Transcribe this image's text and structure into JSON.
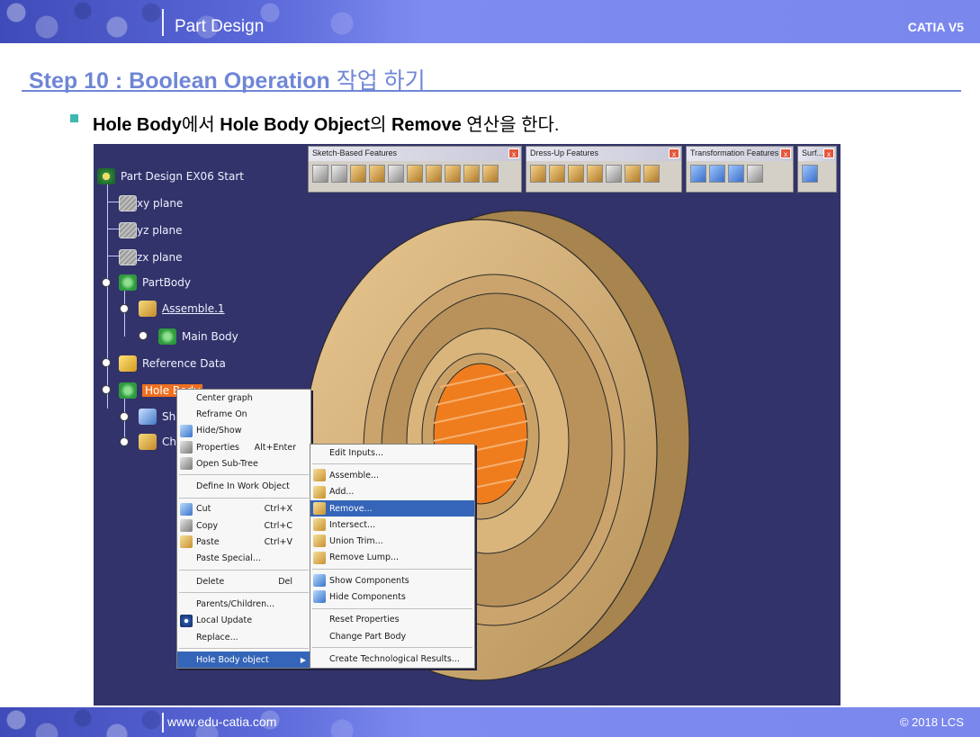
{
  "header": {
    "title": "Part Design",
    "right": "CATIA V5"
  },
  "step": {
    "title_en": "Step 10 : Boolean Operation",
    "title_ko": "작업 하기"
  },
  "bullet": {
    "p1": "Hole Body",
    "p2": "에서 ",
    "p3": "Hole Body Object",
    "p4": "의 ",
    "p5": "Remove",
    "p6": " 연산을 한다."
  },
  "toolbars": [
    {
      "title": "Sketch-Based Features",
      "close": "x"
    },
    {
      "title": "Dress-Up Features",
      "close": "x"
    },
    {
      "title": "Transformation Features",
      "close": "x"
    },
    {
      "title": "Surf...",
      "close": "x"
    }
  ],
  "tree": {
    "root": "Part Design EX06 Start",
    "xy": "xy plane",
    "yz": "yz plane",
    "zx": "zx plane",
    "partbody": "PartBody",
    "assemble": "Assemble.1",
    "mainbody": "Main Body",
    "refdata": "Reference Data",
    "holebody": "Hole Body",
    "sh": "Sh",
    "ch": "Ch"
  },
  "menu1": [
    {
      "label": "Center graph",
      "shortcut": ""
    },
    {
      "label": "Reframe On",
      "shortcut": ""
    },
    {
      "label": "Hide/Show",
      "shortcut": ""
    },
    {
      "label": "Properties",
      "shortcut": "Alt+Enter"
    },
    {
      "label": "Open Sub-Tree",
      "shortcut": ""
    },
    {
      "label": "Define In Work Object",
      "shortcut": ""
    },
    {
      "label": "Cut",
      "shortcut": "Ctrl+X"
    },
    {
      "label": "Copy",
      "shortcut": "Ctrl+C"
    },
    {
      "label": "Paste",
      "shortcut": "Ctrl+V"
    },
    {
      "label": "Paste Special...",
      "shortcut": ""
    },
    {
      "label": "Delete",
      "shortcut": "Del"
    },
    {
      "label": "Parents/Children...",
      "shortcut": ""
    },
    {
      "label": "Local Update",
      "shortcut": ""
    },
    {
      "label": "Replace...",
      "shortcut": ""
    },
    {
      "label": "Hole Body object",
      "shortcut": ""
    }
  ],
  "menu2": [
    {
      "label": "Edit Inputs..."
    },
    {
      "label": "Assemble..."
    },
    {
      "label": "Add..."
    },
    {
      "label": "Remove..."
    },
    {
      "label": "Intersect..."
    },
    {
      "label": "Union Trim..."
    },
    {
      "label": "Remove Lump..."
    },
    {
      "label": "Show Components"
    },
    {
      "label": "Hide Components"
    },
    {
      "label": "Reset Properties"
    },
    {
      "label": "Change Part Body"
    },
    {
      "label": "Create Technological Results..."
    }
  ],
  "footer": {
    "url": "www.edu-catia.com",
    "right": "© 2018 LCS"
  }
}
